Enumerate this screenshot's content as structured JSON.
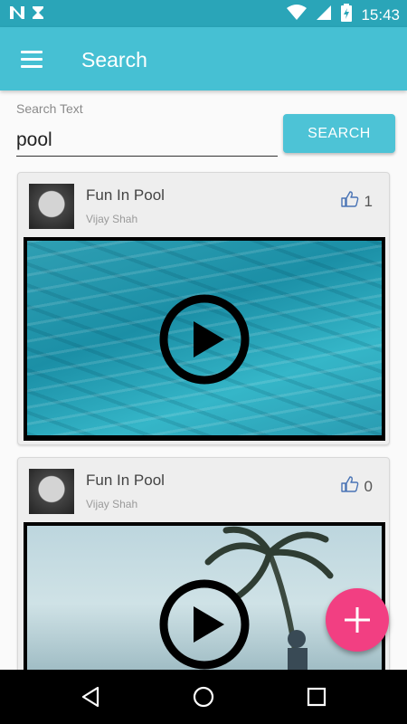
{
  "status_bar": {
    "left_icons": [
      "n-notification-icon",
      "hourglass-notification-icon"
    ],
    "right_icons": [
      "wifi-icon",
      "cell-signal-icon",
      "battery-charging-icon"
    ],
    "time": "15:43"
  },
  "app_bar": {
    "title": "Search",
    "menu_icon": "hamburger-menu-icon"
  },
  "search": {
    "label": "Search Text",
    "value": "pool",
    "button_label": "SEARCH"
  },
  "results": [
    {
      "title": "Fun In Pool",
      "author": "Vijay Shah",
      "likes": "1",
      "thumbnail": "pool"
    },
    {
      "title": "Fun In Pool",
      "author": "Vijay Shah",
      "likes": "0",
      "thumbnail": "beach"
    }
  ],
  "colors": {
    "status_bar": "#2aa5b8",
    "app_bar": "#46c0d3",
    "button": "#4dc3d6",
    "fab": "#f23f82"
  },
  "fab": {
    "icon": "plus-icon"
  },
  "nav_bar": {
    "icons": [
      "back-icon",
      "home-icon",
      "recents-icon"
    ]
  }
}
